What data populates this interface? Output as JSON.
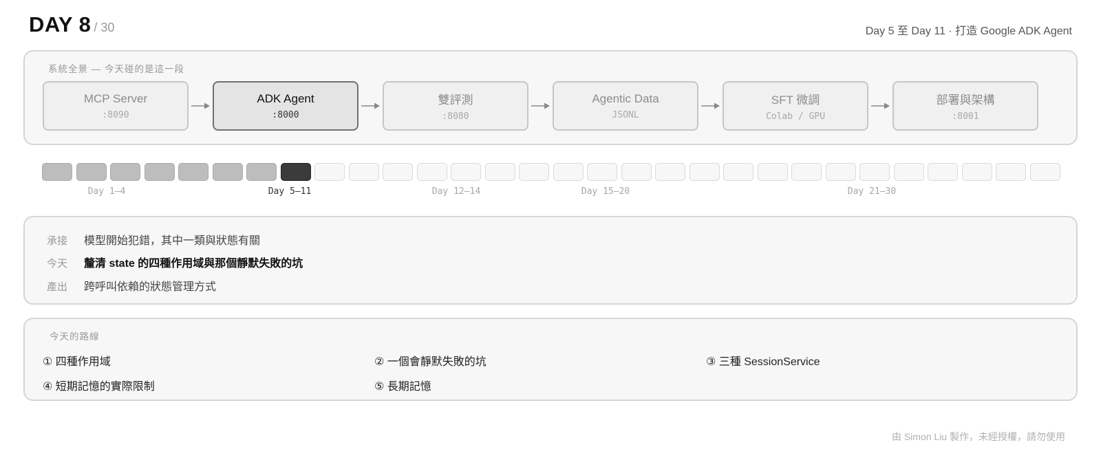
{
  "header": {
    "day": "DAY 8",
    "total": "/ 30",
    "phase": "Day 5 至 Day 11 · 打造 Google ADK Agent"
  },
  "overview": {
    "label": "系統全景 — 今天碰的是這一段",
    "nodes": [
      {
        "name": "MCP Server",
        "sub": ":8090"
      },
      {
        "name": "ADK Agent",
        "sub": ":8000"
      },
      {
        "name": "雙評測",
        "sub": ":8080"
      },
      {
        "name": "Agentic Data",
        "sub": "JSONL"
      },
      {
        "name": "SFT 微調",
        "sub": "Colab / GPU"
      },
      {
        "name": "部署與架構",
        "sub": ":8001"
      }
    ],
    "active_index": 1
  },
  "timeline": {
    "total_days": 30,
    "current_day": 8,
    "labels": [
      "Day 1–4",
      "Day 5–11",
      "Day 12–14",
      "Day 15–20",
      "Day 21–30"
    ],
    "current_label_index": 1
  },
  "context": {
    "rows": [
      {
        "key": "承接",
        "value": "模型開始犯錯，其中一類與狀態有關",
        "emphasis": false
      },
      {
        "key": "今天",
        "value": "釐清 state 的四種作用域與那個靜默失敗的坑",
        "emphasis": true
      },
      {
        "key": "產出",
        "value": "跨呼叫依賴的狀態管理方式",
        "emphasis": false
      }
    ]
  },
  "route": {
    "label": "今天的路線",
    "items": [
      "① 四種作用域",
      "② 一個會靜默失敗的坑",
      "③ 三種 SessionService",
      "④ 短期記憶的實際限制",
      "⑤ 長期記憶"
    ]
  },
  "footer": "由 Simon Liu 製作，未經授權，請勿使用"
}
